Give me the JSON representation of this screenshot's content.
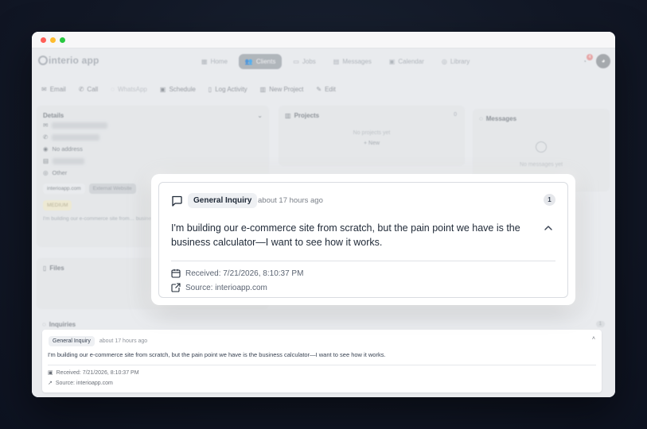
{
  "app": {
    "logo": "interio app",
    "nav": [
      {
        "label": "Home",
        "icon": "grid-icon",
        "active": false
      },
      {
        "label": "Clients",
        "icon": "users-icon",
        "active": true
      },
      {
        "label": "Jobs",
        "icon": "folder-icon",
        "active": false
      },
      {
        "label": "Messages",
        "icon": "document-icon",
        "active": false
      },
      {
        "label": "Calendar",
        "icon": "calendar-icon",
        "active": false
      },
      {
        "label": "Library",
        "icon": "globe-icon",
        "active": false
      }
    ],
    "notification_count": "4"
  },
  "toolbar": {
    "email": "Email",
    "call": "Call",
    "whatsapp": "WhatsApp",
    "schedule": "Schedule",
    "log_activity": "Log Activity",
    "new_project": "New Project",
    "edit": "Edit"
  },
  "details": {
    "title": "Details",
    "address": "No address",
    "source": "Other",
    "chip_site": "interioapp.com",
    "chip_external": "External Website",
    "chip_priority": "MEDIUM",
    "note": "I'm building our e-commerce site from… business calculator—I want to see how…"
  },
  "projects": {
    "title": "Projects",
    "count": "0",
    "empty": "No projects yet",
    "new": "New"
  },
  "messages": {
    "title": "Messages",
    "empty": "No messages yet"
  },
  "files": {
    "title": "Files"
  },
  "inquiries": {
    "title": "Inquiries",
    "count": "1",
    "item": {
      "type": "General Inquiry",
      "time": "about 17 hours ago",
      "body": "I'm building our e-commerce site from scratch, but the pain point we have is the business calculator—I want to see how it works.",
      "received": "Received: 7/21/2026, 8:10:37 PM",
      "source": "Source: interioapp.com"
    }
  },
  "modal": {
    "type": "General Inquiry",
    "time": "about 17 hours ago",
    "count": "1",
    "body": "I'm building our e-commerce site from scratch, but the pain point we have is the business calculator—I want to see how it works.",
    "received": "Received: 7/21/2026, 8:10:37 PM",
    "source": "Source: interioapp.com"
  }
}
